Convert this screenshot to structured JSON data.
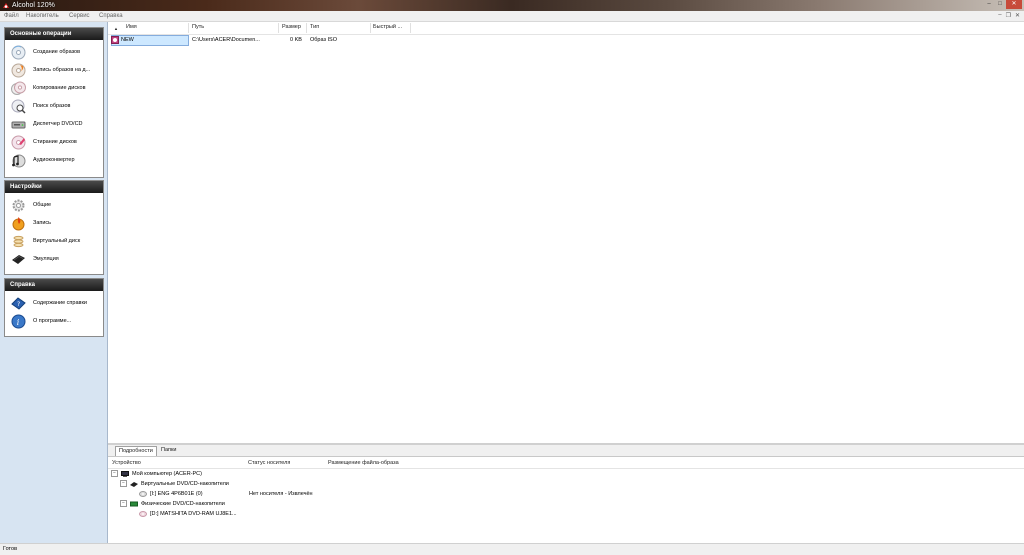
{
  "window": {
    "title": "Alcohol 120%",
    "ghost_tabs": [
      "",
      "",
      ""
    ]
  },
  "menu": [
    "Файл",
    "Накопитель",
    "Сервис",
    "Справка"
  ],
  "sidebar": {
    "panels": [
      {
        "title": "Основные операции",
        "items": [
          {
            "label": "Создание образов",
            "icon": "create-image-icon"
          },
          {
            "label": "Запись образов на д...",
            "icon": "burn-image-icon"
          },
          {
            "label": "Копирование дисков",
            "icon": "copy-disc-icon"
          },
          {
            "label": "Поиск образов",
            "icon": "search-image-icon"
          },
          {
            "label": "Диспетчер DVD/CD",
            "icon": "drive-manager-icon"
          },
          {
            "label": "Стирание дисков",
            "icon": "erase-disc-icon"
          },
          {
            "label": "Аудиоконвертер",
            "icon": "audio-converter-icon"
          }
        ]
      },
      {
        "title": "Настройки",
        "items": [
          {
            "label": "Общие",
            "icon": "gear-icon"
          },
          {
            "label": "Запись",
            "icon": "record-icon"
          },
          {
            "label": "Виртуальный диск",
            "icon": "virtual-disk-icon"
          },
          {
            "label": "Эмуляция",
            "icon": "emulation-icon"
          }
        ]
      },
      {
        "title": "Справка",
        "items": [
          {
            "label": "Содержание справки",
            "icon": "help-book-icon"
          },
          {
            "label": "О программе...",
            "icon": "info-icon"
          }
        ]
      }
    ]
  },
  "file_list": {
    "columns": [
      "Имя",
      "Путь",
      "Размер",
      "Тип",
      "Быстрый ..."
    ],
    "rows": [
      {
        "name": "NEW",
        "path": "C:\\Users\\ACER\\Documen...",
        "size": "0 KB",
        "type": "Образ ISO",
        "quick": ""
      }
    ]
  },
  "bottom": {
    "tabs": [
      "Подробности",
      "Папки"
    ],
    "columns": [
      "Устройство",
      "Статус носителя",
      "Размещение файла-образа"
    ],
    "tree": [
      {
        "label": "Мой компьютер (ACER-PC)",
        "status": "",
        "location": "",
        "icon": "computer-icon"
      },
      {
        "label": "Виртуальные DVD/CD-накопители",
        "status": "",
        "location": "",
        "icon": "virtual-drives-icon"
      },
      {
        "label": "[I:] ENG 4P6B01E (0)",
        "status": "Нет носителя - Извлечён",
        "location": "",
        "icon": "virtual-drive-icon"
      },
      {
        "label": "Физические DVD/CD-накопители",
        "status": "",
        "location": "",
        "icon": "physical-drives-icon"
      },
      {
        "label": "[D:] MATSHITA DVD-RAM UJ8E1...",
        "status": "",
        "location": "",
        "icon": "physical-drive-icon"
      }
    ]
  },
  "status": "Готов",
  "colors": {
    "sidebar_bg": "#d7e4f2",
    "panel_header": "#1a1a1a",
    "selection": "#cde8ff"
  }
}
